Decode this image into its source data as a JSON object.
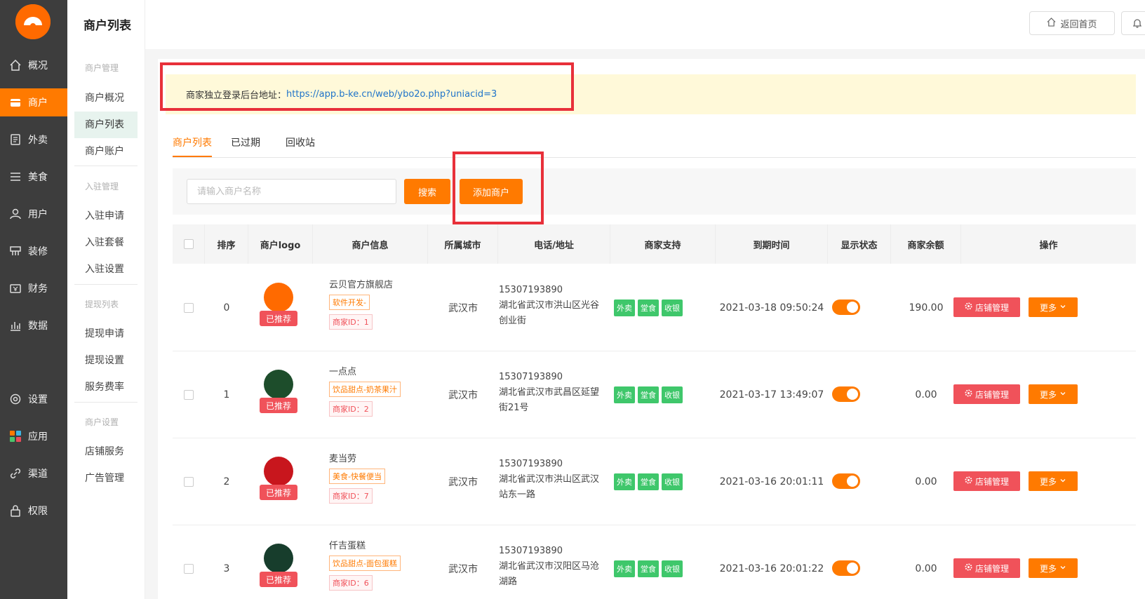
{
  "page": {
    "title": "商户列表"
  },
  "rail": {
    "items": [
      {
        "label": "概况",
        "icon": "home-icon"
      },
      {
        "label": "商户",
        "icon": "store-icon",
        "active": true
      },
      {
        "label": "外卖",
        "icon": "document-icon"
      },
      {
        "label": "美食",
        "icon": "list-icon"
      },
      {
        "label": "用户",
        "icon": "user-icon"
      },
      {
        "label": "装修",
        "icon": "decorate-icon"
      },
      {
        "label": "财务",
        "icon": "finance-icon"
      },
      {
        "label": "数据",
        "icon": "chart-icon"
      },
      {
        "label": "设置",
        "icon": "gear-icon"
      },
      {
        "label": "应用",
        "icon": "apps-icon"
      },
      {
        "label": "渠道",
        "icon": "channel-icon"
      },
      {
        "label": "权限",
        "icon": "lock-icon"
      }
    ]
  },
  "subnav": {
    "group1": "商户管理",
    "item1": "商户概况",
    "item2": "商户列表",
    "item3": "商户账户",
    "group2": "入驻管理",
    "item4": "入驻申请",
    "item5": "入驻套餐",
    "item6": "入驻设置",
    "group3": "提现列表",
    "item7": "提现申请",
    "item8": "提现设置",
    "item9": "服务费率",
    "group4": "商户设置",
    "item10": "店铺服务",
    "item11": "广告管理"
  },
  "header": {
    "home_label": "返回首页"
  },
  "notice": {
    "label": "商家独立登录后台地址：",
    "url": "https://app.b-ke.cn/web/ybo2o.php?uniacid=3"
  },
  "tabs": {
    "t1": "商户列表",
    "t2": "已过期",
    "t3": "回收站"
  },
  "search": {
    "placeholder": "请输入商户名称",
    "search_label": "搜索",
    "add_label": "添加商户"
  },
  "table": {
    "headers": {
      "order": "排序",
      "logo": "商户logo",
      "info": "商户信息",
      "city": "所属城市",
      "contact": "电话/地址",
      "support": "商家支持",
      "expire": "到期时间",
      "status": "显示状态",
      "balance": "商家余额",
      "ops": "操作"
    },
    "rows": [
      {
        "order": "0",
        "name": "云贝官方旗舰店",
        "category": "软件开发-",
        "shop_id": "商家ID：1",
        "recommend": "已推荐",
        "city": "武汉市",
        "phone": "15307193890",
        "address": "湖北省武汉市洪山区光谷创业街",
        "s1": "外卖",
        "s2": "堂食",
        "s3": "收银",
        "expire": "2021-03-18 09:50:24",
        "balance": "190.00",
        "manage": "店铺管理",
        "more": "更多",
        "logo_color": "#ff6a00"
      },
      {
        "order": "1",
        "name": "一点点",
        "category": "饮品甜点-奶茶果汁",
        "shop_id": "商家ID：2",
        "recommend": "已推荐",
        "city": "武汉市",
        "phone": "15307193890",
        "address": "湖北省武汉市武昌区延望街21号",
        "s1": "外卖",
        "s2": "堂食",
        "s3": "收银",
        "expire": "2021-03-17 13:49:07",
        "balance": "0.00",
        "manage": "店铺管理",
        "more": "更多",
        "logo_color": "#1d4d2b"
      },
      {
        "order": "2",
        "name": "麦当劳",
        "category": "美食-快餐便当",
        "shop_id": "商家ID：7",
        "recommend": "已推荐",
        "city": "武汉市",
        "phone": "15307193890",
        "address": "湖北省武汉市洪山区武汉站东一路",
        "s1": "外卖",
        "s2": "堂食",
        "s3": "收银",
        "expire": "2021-03-16 20:01:11",
        "balance": "0.00",
        "manage": "店铺管理",
        "more": "更多",
        "logo_color": "#c8161d"
      },
      {
        "order": "3",
        "name": "仟吉蛋糕",
        "category": "饮品甜点-面包蛋糕",
        "shop_id": "商家ID：6",
        "recommend": "已推荐",
        "city": "武汉市",
        "phone": "15307193890",
        "address": "湖北省武汉市汉阳区马沧湖路",
        "s1": "外卖",
        "s2": "堂食",
        "s3": "收银",
        "expire": "2021-03-16 20:01:22",
        "balance": "0.00",
        "manage": "店铺管理",
        "more": "更多",
        "logo_color": "#173d2c"
      }
    ]
  }
}
